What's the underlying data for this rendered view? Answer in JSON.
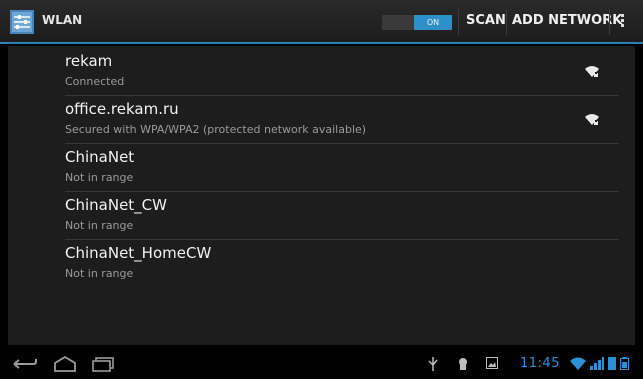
{
  "action_bar": {
    "title": "WLAN",
    "toggle_label": "ON",
    "scan_label": "SCAN",
    "add_network_label": "ADD NETWORK",
    "accent_color": "#2f8fc8"
  },
  "networks": [
    {
      "name": "rekam",
      "status": "Connected",
      "signal_icon": "wifi-signal-icon"
    },
    {
      "name": "office.rekam.ru",
      "status": "Secured with WPA/WPA2 (protected network available)",
      "signal_icon": "wifi-signal-icon"
    },
    {
      "name": "ChinaNet",
      "status": "Not in range"
    },
    {
      "name": "ChinaNet_CW",
      "status": "Not in range"
    },
    {
      "name": "ChinaNet_HomeCW",
      "status": "Not in range"
    }
  ],
  "system_bar": {
    "time": "11:45",
    "icons": [
      "back-icon",
      "home-icon",
      "recent-apps-icon",
      "usb-icon",
      "android-debug-icon",
      "gallery-icon",
      "wifi-status-icon",
      "signal-bars-icon",
      "battery-icon"
    ]
  }
}
